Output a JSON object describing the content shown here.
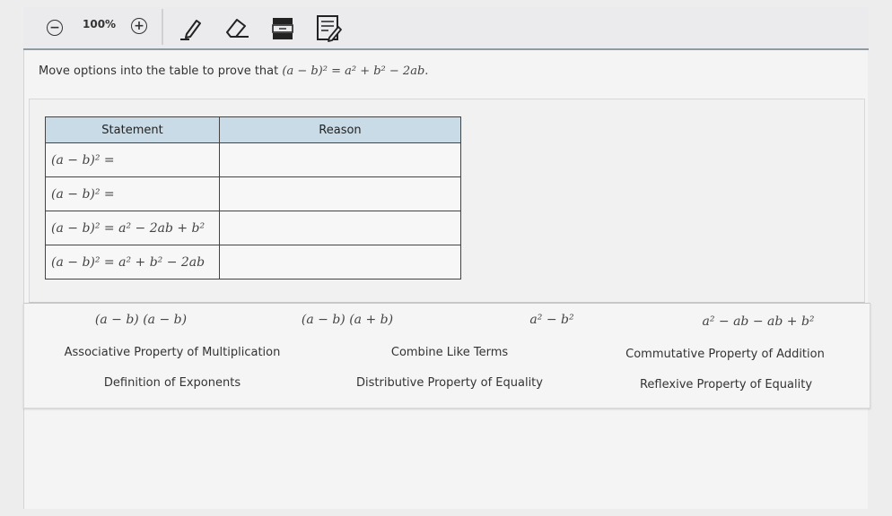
{
  "toolbar": {
    "zoom_level": "100%",
    "zoom_out_symbol": "−",
    "zoom_in_symbol": "+",
    "icons": [
      "zoom-out-icon",
      "zoom-in-icon",
      "pencil-icon",
      "eraser-icon",
      "line-reader-icon",
      "notepad-icon"
    ]
  },
  "prompt": {
    "text": "Move options into the table to prove that ",
    "equation": "(a − b)² = a² + b² − 2ab."
  },
  "table": {
    "headers": {
      "statement": "Statement",
      "reason": "Reason"
    },
    "rows": [
      {
        "statement": "(a − b)² =",
        "reason": ""
      },
      {
        "statement": "(a − b)² =",
        "reason": ""
      },
      {
        "statement": "(a − b)² = a² − 2ab + b²",
        "reason": ""
      },
      {
        "statement": "(a − b)² = a² + b² − 2ab",
        "reason": ""
      }
    ]
  },
  "options": {
    "expr_1": "(a − b) (a − b)",
    "expr_2": "(a − b) (a + b)",
    "expr_3": "a² − b²",
    "expr_4": "a² − ab − ab + b²",
    "associative": "Associative Property of Multiplication",
    "combine": "Combine Like Terms",
    "commutative": "Commutative Property of Addition",
    "exponents": "Definition of Exponents",
    "distributive": "Distributive Property of Equality",
    "reflexive": "Reflexive Property of Equality"
  },
  "colors": {
    "header_bg": "#c9dbe7",
    "toolbar_rule": "#8f9aa3"
  }
}
